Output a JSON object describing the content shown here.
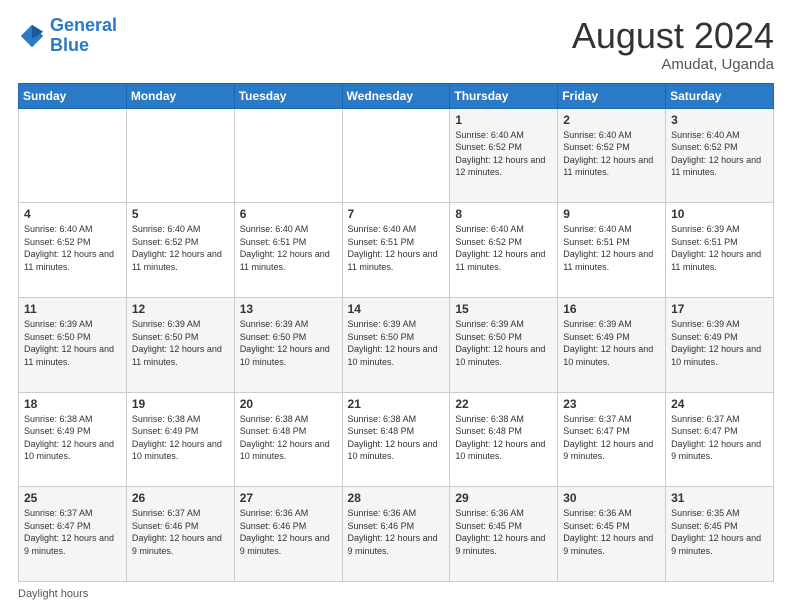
{
  "header": {
    "logo_line1": "General",
    "logo_line2": "Blue",
    "month_title": "August 2024",
    "location": "Amudat, Uganda"
  },
  "footer": {
    "daylight_label": "Daylight hours"
  },
  "weekdays": [
    "Sunday",
    "Monday",
    "Tuesday",
    "Wednesday",
    "Thursday",
    "Friday",
    "Saturday"
  ],
  "weeks": [
    [
      {
        "day": "",
        "sunrise": "",
        "sunset": "",
        "daylight": ""
      },
      {
        "day": "",
        "sunrise": "",
        "sunset": "",
        "daylight": ""
      },
      {
        "day": "",
        "sunrise": "",
        "sunset": "",
        "daylight": ""
      },
      {
        "day": "",
        "sunrise": "",
        "sunset": "",
        "daylight": ""
      },
      {
        "day": "1",
        "sunrise": "Sunrise: 6:40 AM",
        "sunset": "Sunset: 6:52 PM",
        "daylight": "Daylight: 12 hours and 12 minutes."
      },
      {
        "day": "2",
        "sunrise": "Sunrise: 6:40 AM",
        "sunset": "Sunset: 6:52 PM",
        "daylight": "Daylight: 12 hours and 11 minutes."
      },
      {
        "day": "3",
        "sunrise": "Sunrise: 6:40 AM",
        "sunset": "Sunset: 6:52 PM",
        "daylight": "Daylight: 12 hours and 11 minutes."
      }
    ],
    [
      {
        "day": "4",
        "sunrise": "Sunrise: 6:40 AM",
        "sunset": "Sunset: 6:52 PM",
        "daylight": "Daylight: 12 hours and 11 minutes."
      },
      {
        "day": "5",
        "sunrise": "Sunrise: 6:40 AM",
        "sunset": "Sunset: 6:52 PM",
        "daylight": "Daylight: 12 hours and 11 minutes."
      },
      {
        "day": "6",
        "sunrise": "Sunrise: 6:40 AM",
        "sunset": "Sunset: 6:51 PM",
        "daylight": "Daylight: 12 hours and 11 minutes."
      },
      {
        "day": "7",
        "sunrise": "Sunrise: 6:40 AM",
        "sunset": "Sunset: 6:51 PM",
        "daylight": "Daylight: 12 hours and 11 minutes."
      },
      {
        "day": "8",
        "sunrise": "Sunrise: 6:40 AM",
        "sunset": "Sunset: 6:52 PM",
        "daylight": "Daylight: 12 hours and 11 minutes."
      },
      {
        "day": "9",
        "sunrise": "Sunrise: 6:40 AM",
        "sunset": "Sunset: 6:51 PM",
        "daylight": "Daylight: 12 hours and 11 minutes."
      },
      {
        "day": "10",
        "sunrise": "Sunrise: 6:39 AM",
        "sunset": "Sunset: 6:51 PM",
        "daylight": "Daylight: 12 hours and 11 minutes."
      }
    ],
    [
      {
        "day": "11",
        "sunrise": "Sunrise: 6:39 AM",
        "sunset": "Sunset: 6:50 PM",
        "daylight": "Daylight: 12 hours and 11 minutes."
      },
      {
        "day": "12",
        "sunrise": "Sunrise: 6:39 AM",
        "sunset": "Sunset: 6:50 PM",
        "daylight": "Daylight: 12 hours and 11 minutes."
      },
      {
        "day": "13",
        "sunrise": "Sunrise: 6:39 AM",
        "sunset": "Sunset: 6:50 PM",
        "daylight": "Daylight: 12 hours and 10 minutes."
      },
      {
        "day": "14",
        "sunrise": "Sunrise: 6:39 AM",
        "sunset": "Sunset: 6:50 PM",
        "daylight": "Daylight: 12 hours and 10 minutes."
      },
      {
        "day": "15",
        "sunrise": "Sunrise: 6:39 AM",
        "sunset": "Sunset: 6:50 PM",
        "daylight": "Daylight: 12 hours and 10 minutes."
      },
      {
        "day": "16",
        "sunrise": "Sunrise: 6:39 AM",
        "sunset": "Sunset: 6:49 PM",
        "daylight": "Daylight: 12 hours and 10 minutes."
      },
      {
        "day": "17",
        "sunrise": "Sunrise: 6:39 AM",
        "sunset": "Sunset: 6:49 PM",
        "daylight": "Daylight: 12 hours and 10 minutes."
      }
    ],
    [
      {
        "day": "18",
        "sunrise": "Sunrise: 6:38 AM",
        "sunset": "Sunset: 6:49 PM",
        "daylight": "Daylight: 12 hours and 10 minutes."
      },
      {
        "day": "19",
        "sunrise": "Sunrise: 6:38 AM",
        "sunset": "Sunset: 6:49 PM",
        "daylight": "Daylight: 12 hours and 10 minutes."
      },
      {
        "day": "20",
        "sunrise": "Sunrise: 6:38 AM",
        "sunset": "Sunset: 6:48 PM",
        "daylight": "Daylight: 12 hours and 10 minutes."
      },
      {
        "day": "21",
        "sunrise": "Sunrise: 6:38 AM",
        "sunset": "Sunset: 6:48 PM",
        "daylight": "Daylight: 12 hours and 10 minutes."
      },
      {
        "day": "22",
        "sunrise": "Sunrise: 6:38 AM",
        "sunset": "Sunset: 6:48 PM",
        "daylight": "Daylight: 12 hours and 10 minutes."
      },
      {
        "day": "23",
        "sunrise": "Sunrise: 6:37 AM",
        "sunset": "Sunset: 6:47 PM",
        "daylight": "Daylight: 12 hours and 9 minutes."
      },
      {
        "day": "24",
        "sunrise": "Sunrise: 6:37 AM",
        "sunset": "Sunset: 6:47 PM",
        "daylight": "Daylight: 12 hours and 9 minutes."
      }
    ],
    [
      {
        "day": "25",
        "sunrise": "Sunrise: 6:37 AM",
        "sunset": "Sunset: 6:47 PM",
        "daylight": "Daylight: 12 hours and 9 minutes."
      },
      {
        "day": "26",
        "sunrise": "Sunrise: 6:37 AM",
        "sunset": "Sunset: 6:46 PM",
        "daylight": "Daylight: 12 hours and 9 minutes."
      },
      {
        "day": "27",
        "sunrise": "Sunrise: 6:36 AM",
        "sunset": "Sunset: 6:46 PM",
        "daylight": "Daylight: 12 hours and 9 minutes."
      },
      {
        "day": "28",
        "sunrise": "Sunrise: 6:36 AM",
        "sunset": "Sunset: 6:46 PM",
        "daylight": "Daylight: 12 hours and 9 minutes."
      },
      {
        "day": "29",
        "sunrise": "Sunrise: 6:36 AM",
        "sunset": "Sunset: 6:45 PM",
        "daylight": "Daylight: 12 hours and 9 minutes."
      },
      {
        "day": "30",
        "sunrise": "Sunrise: 6:36 AM",
        "sunset": "Sunset: 6:45 PM",
        "daylight": "Daylight: 12 hours and 9 minutes."
      },
      {
        "day": "31",
        "sunrise": "Sunrise: 6:35 AM",
        "sunset": "Sunset: 6:45 PM",
        "daylight": "Daylight: 12 hours and 9 minutes."
      }
    ]
  ]
}
